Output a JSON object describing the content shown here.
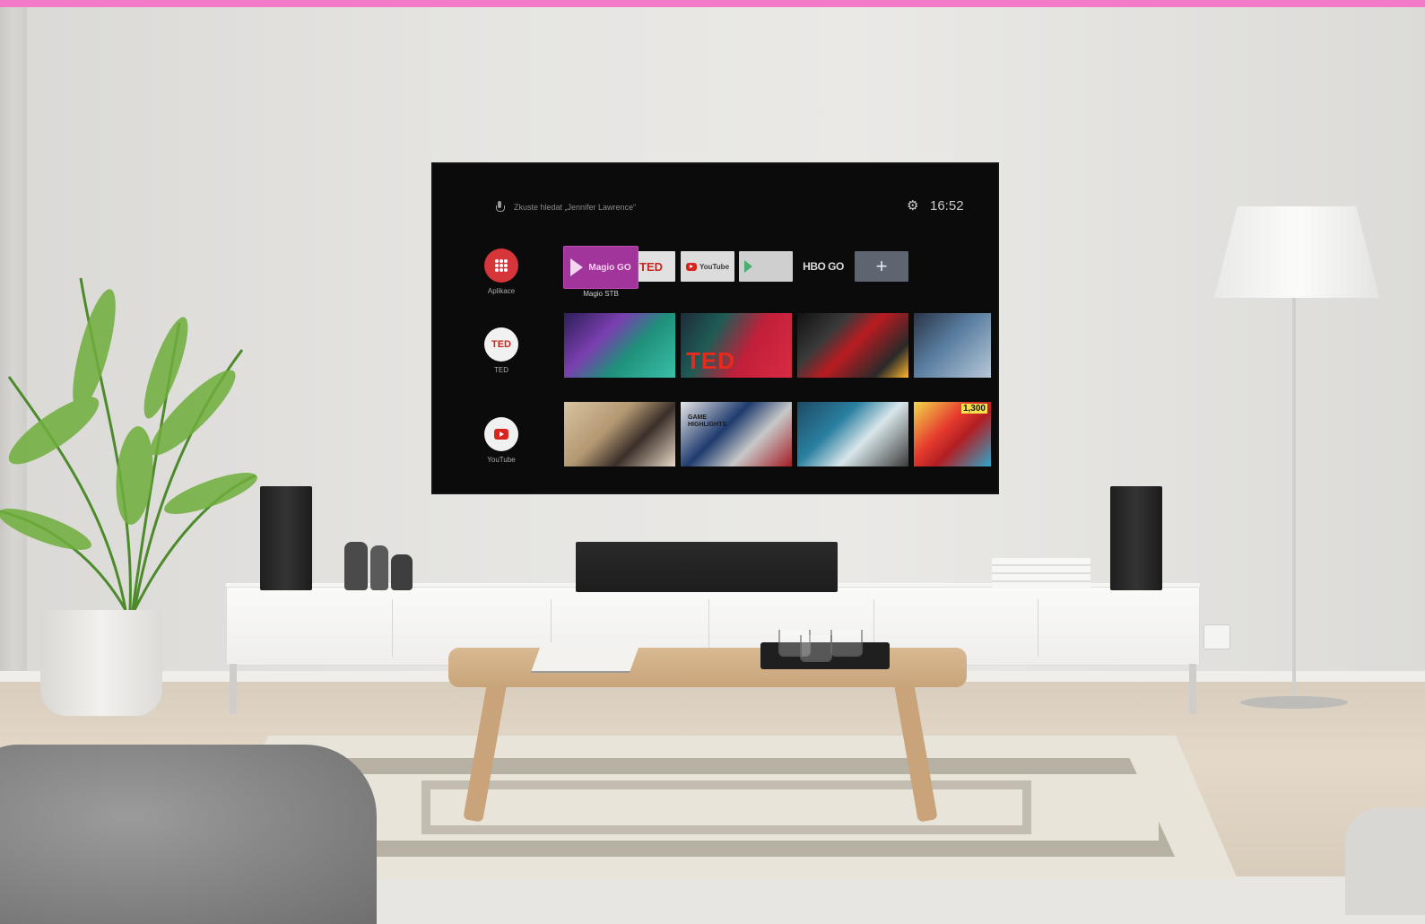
{
  "colors": {
    "accent_bar": "#f27ac8",
    "magio_tile": "#a2359b",
    "ted_red": "#c4271e",
    "youtube_red": "#d7251d"
  },
  "tv": {
    "search": {
      "icon": "mic-icon",
      "hint": "Zkuste hledat „Jennifer Lawrence“"
    },
    "settings_icon": "gear-icon",
    "clock": "16:52",
    "sidebar": [
      {
        "label": "Aplikace",
        "icon": "apps-grid-icon"
      },
      {
        "label": "TED",
        "icon": "ted-logo"
      },
      {
        "label": "YouTube",
        "icon": "youtube-icon"
      }
    ],
    "apps_row": {
      "magio": {
        "text": "Magio GO",
        "caption": "Magio STB"
      },
      "ted": "TED",
      "youtube": "YouTube",
      "play_icon": "google-play-icon",
      "hbo": "HBO GO",
      "add": "+"
    },
    "thumbnails": {
      "ted_row": [
        "",
        "TED",
        "",
        ""
      ],
      "youtube_row": [
        "",
        "GAME HIGHLIGHTS",
        "",
        "1,300"
      ]
    }
  }
}
